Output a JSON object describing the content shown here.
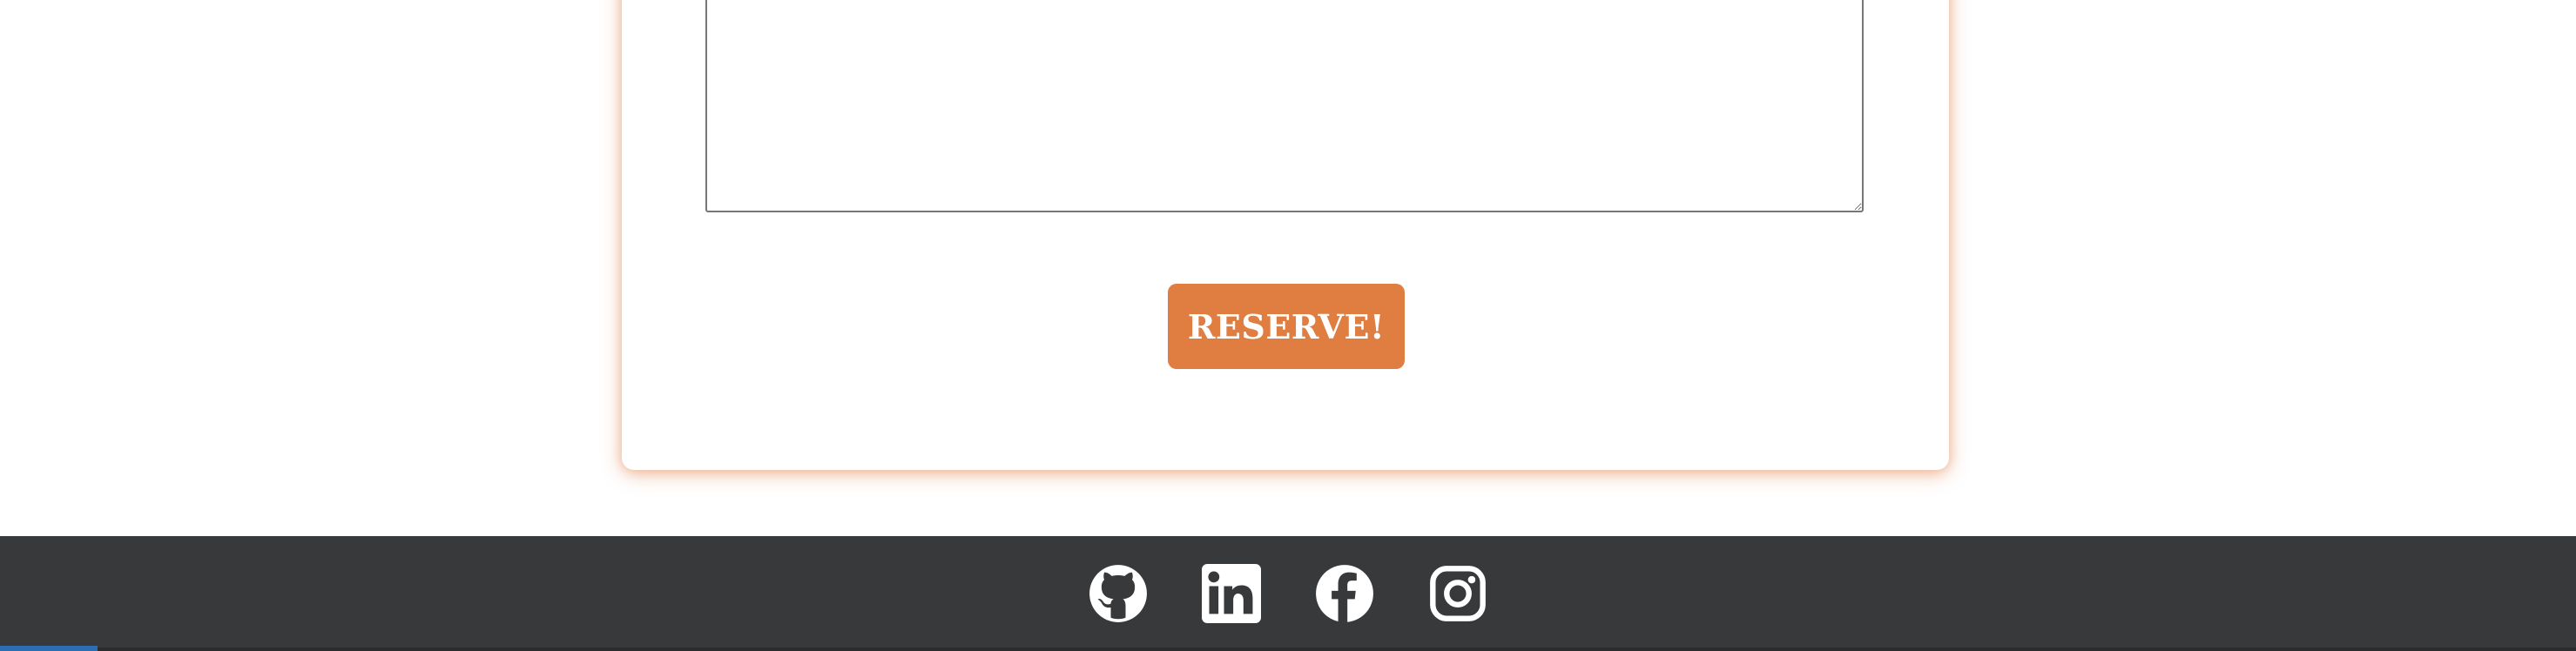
{
  "form": {
    "message_value": "",
    "reserve_label": "RESERVE!"
  },
  "colors": {
    "accent": "#e07e42",
    "footer_bg": "#38393b",
    "icon": "#ffffff"
  },
  "footer": {
    "links": [
      {
        "icon": "github-icon"
      },
      {
        "icon": "linkedin-icon"
      },
      {
        "icon": "facebook-icon"
      },
      {
        "icon": "instagram-icon"
      }
    ]
  }
}
